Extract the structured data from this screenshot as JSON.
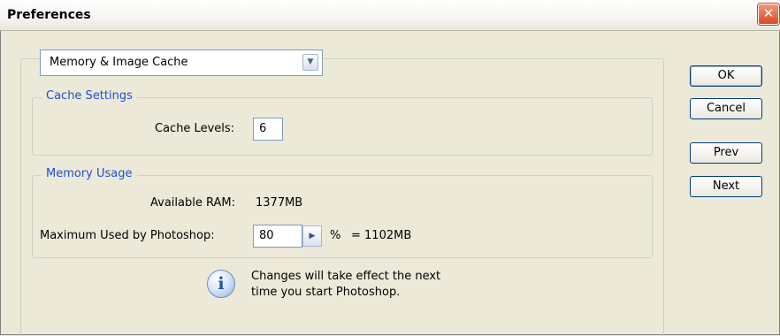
{
  "window": {
    "title": "Preferences",
    "close_label": "✕"
  },
  "panel_select": {
    "value": "Memory & Image Cache",
    "arrow": "chevron-down-icon"
  },
  "cache_settings": {
    "legend": "Cache Settings",
    "cache_levels_label": "Cache Levels:",
    "cache_levels_value": "6"
  },
  "memory_usage": {
    "legend": "Memory Usage",
    "available_ram_label": "Available RAM:",
    "available_ram_value": "1377MB",
    "max_used_label": "Maximum Used by Photoshop:",
    "max_used_value": "80",
    "percent_sign": "%",
    "equals_text": "= 1102MB"
  },
  "notice": {
    "line1": "Changes will take effect the next",
    "line2": "time you start Photoshop.",
    "icon": "info-icon"
  },
  "buttons": {
    "ok": "OK",
    "cancel": "Cancel",
    "prev": "Prev",
    "next": "Next"
  },
  "colors": {
    "legend_text": "#1f4fd1",
    "close_button": "#d94a21",
    "dialog_bg": "#ece9d8"
  }
}
